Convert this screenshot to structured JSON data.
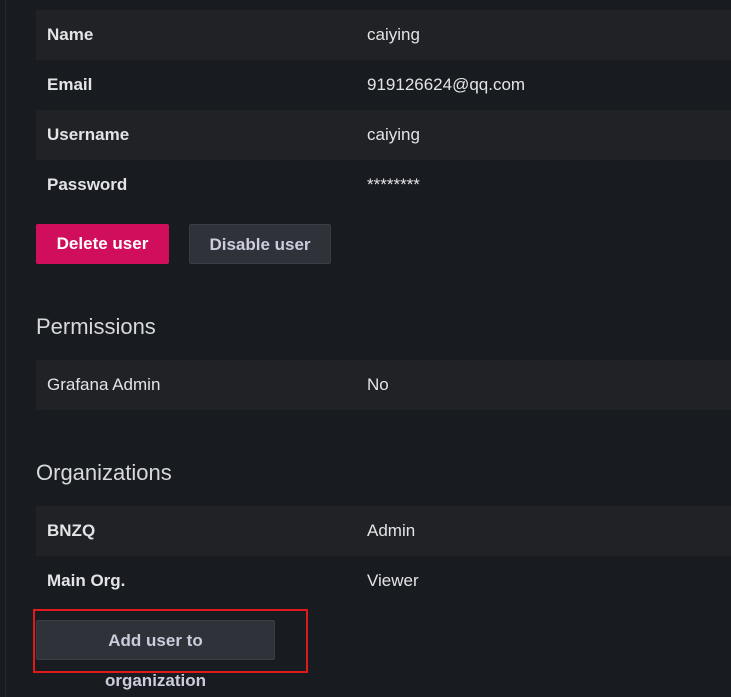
{
  "user_info": {
    "rows": [
      {
        "key": "Name",
        "value": "caiying"
      },
      {
        "key": "Email",
        "value": "919126624@qq.com"
      },
      {
        "key": "Username",
        "value": "caiying"
      },
      {
        "key": "Password",
        "value": "********"
      }
    ]
  },
  "actions": {
    "delete_label": "Delete user",
    "disable_label": "Disable user"
  },
  "permissions": {
    "title": "Permissions",
    "rows": [
      {
        "key": "Grafana Admin",
        "value": "No"
      }
    ]
  },
  "organizations": {
    "title": "Organizations",
    "rows": [
      {
        "key": "BNZQ",
        "value": "Admin"
      },
      {
        "key": "Main Org.",
        "value": "Viewer"
      }
    ],
    "add_label": "Add user to organization"
  },
  "colors": {
    "background": "#181b1f",
    "row_shaded": "#202226",
    "danger": "#d10e5c",
    "highlight": "#e01a1a"
  }
}
